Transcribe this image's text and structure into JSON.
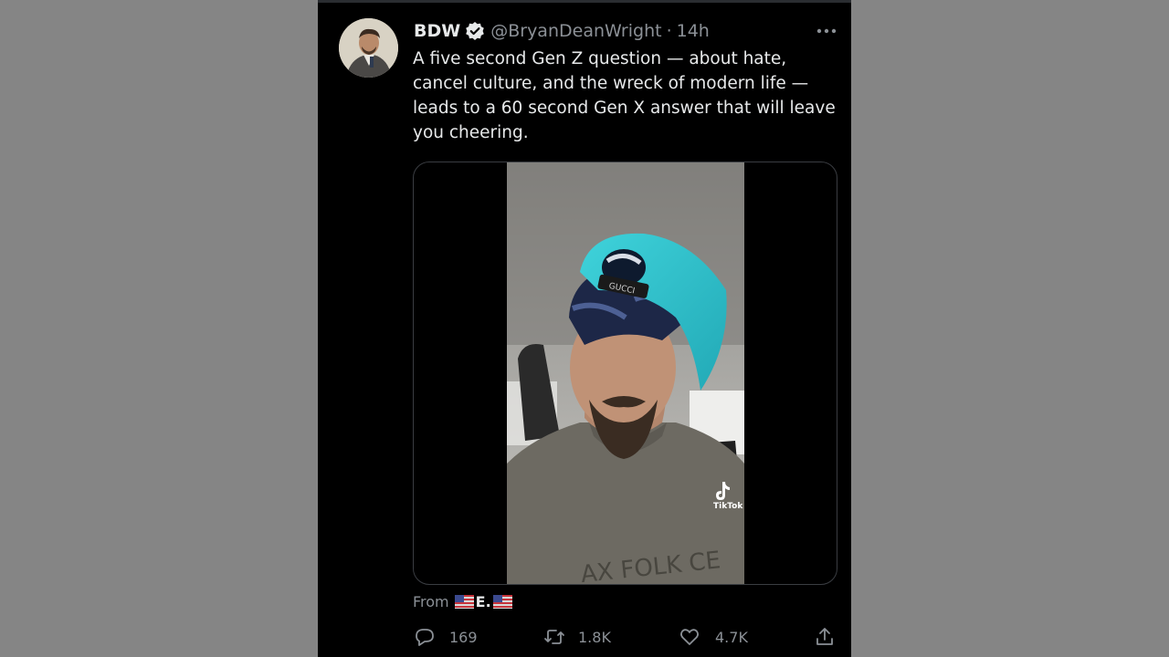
{
  "tweet": {
    "display_name": "BDW",
    "handle": "@BryanDeanWright",
    "separator": "·",
    "time": "14h",
    "text": "A five second Gen Z question — about hate, cancel culture, and the wreck of modern life — leads to a 60 second Gen X answer that will leave you cheering.",
    "verified": true,
    "video_watermark": "TikTok",
    "from_label": "From",
    "from_initial": "E.",
    "from_flag_icon": "us-flag-icon"
  },
  "actions": {
    "reply_count": "169",
    "retweet_count": "1.8K",
    "like_count": "4.7K"
  },
  "colors": {
    "background": "#858585",
    "panel": "#000000",
    "primary_text": "#e7e9ea",
    "secondary_text": "#8b9096"
  }
}
